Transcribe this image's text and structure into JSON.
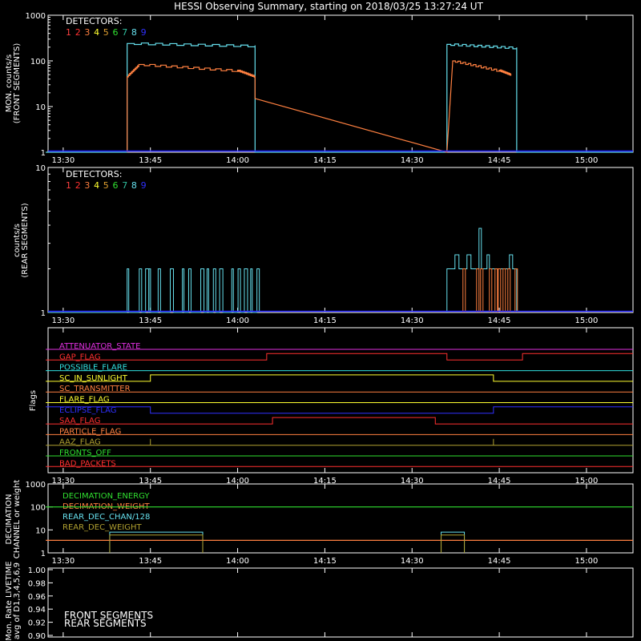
{
  "title": "HESSI Observing Summary, starting on 2018/03/25 13:27:24 UT",
  "colors": {
    "axis": "#ffffff",
    "det_front": "#66e0ee",
    "det_front2": "#ff8040",
    "blue": "#2020ff",
    "detector_digits": [
      "#ff4040",
      "#ff3030",
      "#ff8040",
      "#ffff30",
      "#e0a030",
      "#30e030",
      "#30c0a0",
      "#66e0ee",
      "#3030ff"
    ]
  },
  "time_ticks": [
    "13:30",
    "13:45",
    "14:00",
    "14:15",
    "14:30",
    "14:45",
    "15:00"
  ],
  "panels": {
    "front": {
      "ylabel_1": "MON. counts/s",
      "ylabel_2": "(FRONT SEGMENTS)",
      "yticks": [
        "1000",
        "100",
        "10",
        "1"
      ],
      "legend_title": "DETECTORS:",
      "detectors": [
        "1",
        "2",
        "3",
        "4",
        "5",
        "6",
        "7",
        "8",
        "9"
      ]
    },
    "rear": {
      "ylabel_1": "counts/s",
      "ylabel_2": "(REAR SEGMENTS)",
      "yticks": [
        "10",
        "1"
      ],
      "legend_title": "DETECTORS:",
      "detectors": [
        "1",
        "2",
        "3",
        "4",
        "5",
        "6",
        "7",
        "8",
        "9"
      ]
    },
    "flags": {
      "ylabel": "Flags",
      "items": [
        {
          "label": "ATTENUATOR_STATE",
          "color": "#e030e0"
        },
        {
          "label": "GAP_FLAG",
          "color": "#ff3030"
        },
        {
          "label": "POSSIBLE_FLARE",
          "color": "#30e0e0"
        },
        {
          "label": "SC_IN_SUNLIGHT",
          "color": "#ffff30"
        },
        {
          "label": "SC_TRANSMITTER",
          "color": "#ff8040"
        },
        {
          "label": "FLARE_FLAG",
          "color": "#ffff30"
        },
        {
          "label": "ECLIPSE_FLAG",
          "color": "#3030ff"
        },
        {
          "label": "SAA_FLAG",
          "color": "#ff3030"
        },
        {
          "label": "PARTICLE_FLAG",
          "color": "#ff8040"
        },
        {
          "label": "AAZ_FLAG",
          "color": "#b0a030"
        },
        {
          "label": "FRONTS_OFF",
          "color": "#30e030"
        },
        {
          "label": "BAD_PACKETS",
          "color": "#ff3030"
        }
      ]
    },
    "decimation": {
      "ylabel_1": "DECIMATION",
      "ylabel_2": "CHANNEL or weight",
      "yticks": [
        "1000",
        "100",
        "10",
        "1"
      ],
      "items": [
        {
          "label": "DECIMATION_ENERGY",
          "color": "#30e030"
        },
        {
          "label": "DECIMATION_WEIGHT",
          "color": "#ff8040"
        },
        {
          "label": "REAR_DEC_CHAN/128",
          "color": "#66e0ee"
        },
        {
          "label": "REAR_DEC_WEIGHT",
          "color": "#b0a030"
        }
      ]
    },
    "livetime": {
      "ylabel_1": "Mon. Rate LIVETIME",
      "ylabel_2": "avg of D1,3,4,5,6,9",
      "yticks": [
        "1.00",
        "0.98",
        "0.96",
        "0.94",
        "0.92",
        "0.90"
      ],
      "legend": [
        {
          "label": "FRONT SEGMENTS",
          "color": "#30e030"
        },
        {
          "label": "REAR SEGMENTS",
          "color": "#207020"
        }
      ]
    }
  },
  "chart_data": {
    "type": "line",
    "title": "HESSI Observing Summary, starting on 2018/03/25 13:27:24 UT",
    "x_unit": "UT time",
    "xlim": [
      "13:27:24",
      "15:08"
    ],
    "front_segments": {
      "ylabel": "MON. counts/s (FRONT SEGMENTS)",
      "log_scale": true,
      "ylim": [
        1,
        1000
      ],
      "series": [
        {
          "name": "8",
          "x": [
            "13:27",
            "13:41",
            "13:41",
            "14:03",
            "14:03",
            "14:36",
            "14:36",
            "14:48",
            "14:48",
            "15:08"
          ],
          "y": [
            1,
            1,
            240,
            210,
            1,
            1,
            230,
            190,
            1,
            1
          ]
        },
        {
          "name": "3",
          "x": [
            "13:41",
            "13:41",
            "13:43",
            "14:00",
            "14:03",
            "14:03",
            "14:36",
            "14:37",
            "14:45",
            "14:47"
          ],
          "y": [
            1,
            45,
            80,
            60,
            45,
            15,
            1,
            100,
            60,
            50
          ]
        }
      ]
    },
    "rear_segments": {
      "ylabel": "counts/s (REAR SEGMENTS)",
      "log_scale": true,
      "ylim": [
        1,
        10
      ],
      "series": [
        {
          "name": "8",
          "note": "bursts mostly between 1 and 2 counts/s, 13:41-14:03 and 14:36-14:48, peak ~3.8"
        },
        {
          "name": "3",
          "note": "bursts 1-2 counts/s, 14:39-14:47"
        }
      ]
    },
    "flags": [
      {
        "name": "ATTENUATOR_STATE",
        "x": [
          "13:27",
          "15:08"
        ],
        "y": [
          0,
          0
        ]
      },
      {
        "name": "GAP_FLAG",
        "x": [
          "13:27",
          "14:05",
          "14:05",
          "14:36",
          "14:36",
          "14:49",
          "14:49",
          "15:08"
        ],
        "y": [
          0,
          0,
          1,
          1,
          0,
          0,
          1,
          1
        ]
      },
      {
        "name": "POSSIBLE_FLARE",
        "x": [
          "13:27",
          "15:08"
        ],
        "y": [
          0,
          0
        ]
      },
      {
        "name": "SC_IN_SUNLIGHT",
        "x": [
          "13:27",
          "13:45",
          "13:45",
          "14:44",
          "14:44",
          "15:08"
        ],
        "y": [
          0,
          0,
          1,
          1,
          0,
          0
        ]
      },
      {
        "name": "SC_TRANSMITTER",
        "x": [
          "13:27",
          "15:08"
        ],
        "y": [
          0,
          0
        ]
      },
      {
        "name": "FLARE_FLAG",
        "x": [
          "13:27",
          "15:08"
        ],
        "y": [
          0,
          0
        ]
      },
      {
        "name": "ECLIPSE_FLAG",
        "x": [
          "13:27",
          "13:45",
          "13:45",
          "14:44",
          "14:44",
          "15:08"
        ],
        "y": [
          1,
          1,
          0,
          0,
          1,
          1
        ]
      },
      {
        "name": "SAA_FLAG",
        "x": [
          "13:27",
          "14:06",
          "14:06",
          "14:34",
          "14:34",
          "15:08"
        ],
        "y": [
          0,
          0,
          1,
          1,
          0,
          0
        ]
      },
      {
        "name": "PARTICLE_FLAG",
        "x": [
          "13:27",
          "15:08"
        ],
        "y": [
          0,
          0
        ]
      },
      {
        "name": "AAZ_FLAG",
        "x": [
          "13:27",
          "13:45",
          "13:45",
          "13:45",
          "13:45",
          "14:44",
          "14:44",
          "14:44",
          "14:44",
          "15:08"
        ],
        "y": [
          0,
          0,
          1,
          1,
          0,
          0,
          1,
          1,
          0,
          0
        ]
      },
      {
        "name": "FRONTS_OFF",
        "x": [
          "13:27",
          "15:08"
        ],
        "y": [
          0,
          0
        ]
      },
      {
        "name": "BAD_PACKETS",
        "x": [
          "13:27",
          "15:08"
        ],
        "y": [
          0,
          0
        ]
      }
    ],
    "decimation": {
      "log_scale": true,
      "ylim": [
        1,
        1000
      ],
      "series": [
        {
          "name": "DECIMATION_ENERGY",
          "x": [
            "13:27",
            "15:08"
          ],
          "y": [
            100,
            100
          ]
        },
        {
          "name": "DECIMATION_WEIGHT",
          "x": [
            "13:27",
            "15:08"
          ],
          "y": [
            3.5,
            3.5
          ]
        },
        {
          "name": "REAR_DEC_CHAN/128",
          "x": [
            "13:38",
            "13:38",
            "13:54",
            "13:54",
            "14:35",
            "14:35",
            "14:39",
            "14:39"
          ],
          "y": [
            1,
            8,
            8,
            1,
            1,
            8,
            8,
            1
          ]
        },
        {
          "name": "REAR_DEC_WEIGHT",
          "x": [
            "13:38",
            "13:38",
            "13:54",
            "13:54",
            "14:35",
            "14:35",
            "14:39",
            "14:39"
          ],
          "y": [
            1,
            6,
            6,
            1,
            1,
            6,
            6,
            1
          ]
        }
      ]
    },
    "livetime": {
      "ylim": [
        0.9,
        1.0
      ],
      "series": [
        {
          "name": "FRONT SEGMENTS",
          "values": []
        },
        {
          "name": "REAR SEGMENTS",
          "values": []
        }
      ]
    }
  }
}
